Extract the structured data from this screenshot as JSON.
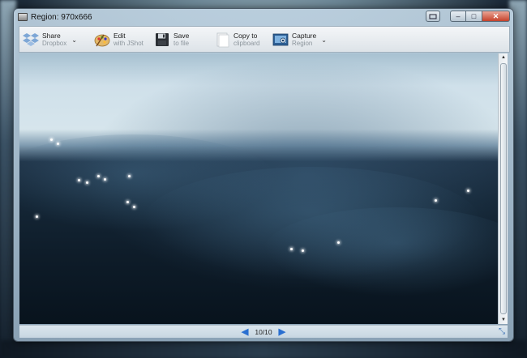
{
  "window": {
    "title": "Region: 970x666",
    "controls": {
      "minimize": "–",
      "maximize": "□",
      "close": "✕"
    }
  },
  "toolbar": {
    "buttons": [
      {
        "label": "Share",
        "sublabel": "Dropbox",
        "icon": "dropbox-icon",
        "has_menu": true
      },
      {
        "label": "Edit",
        "sublabel": "with JShot",
        "icon": "palette-icon",
        "has_menu": false
      },
      {
        "label": "Save",
        "sublabel": "to file",
        "icon": "floppy-disk-icon",
        "has_menu": false
      },
      {
        "label": "Copy to",
        "sublabel": "clipboard",
        "icon": "clipboard-icon",
        "has_menu": false
      },
      {
        "label": "Capture",
        "sublabel": "Region",
        "icon": "camera-icon",
        "has_menu": true
      }
    ]
  },
  "status": {
    "page_indicator": "10/10",
    "prev_icon": "arrow-left-icon",
    "next_icon": "arrow-right-icon"
  },
  "colors": {
    "accent": "#2a6fd0",
    "close_button": "#c5422b"
  }
}
